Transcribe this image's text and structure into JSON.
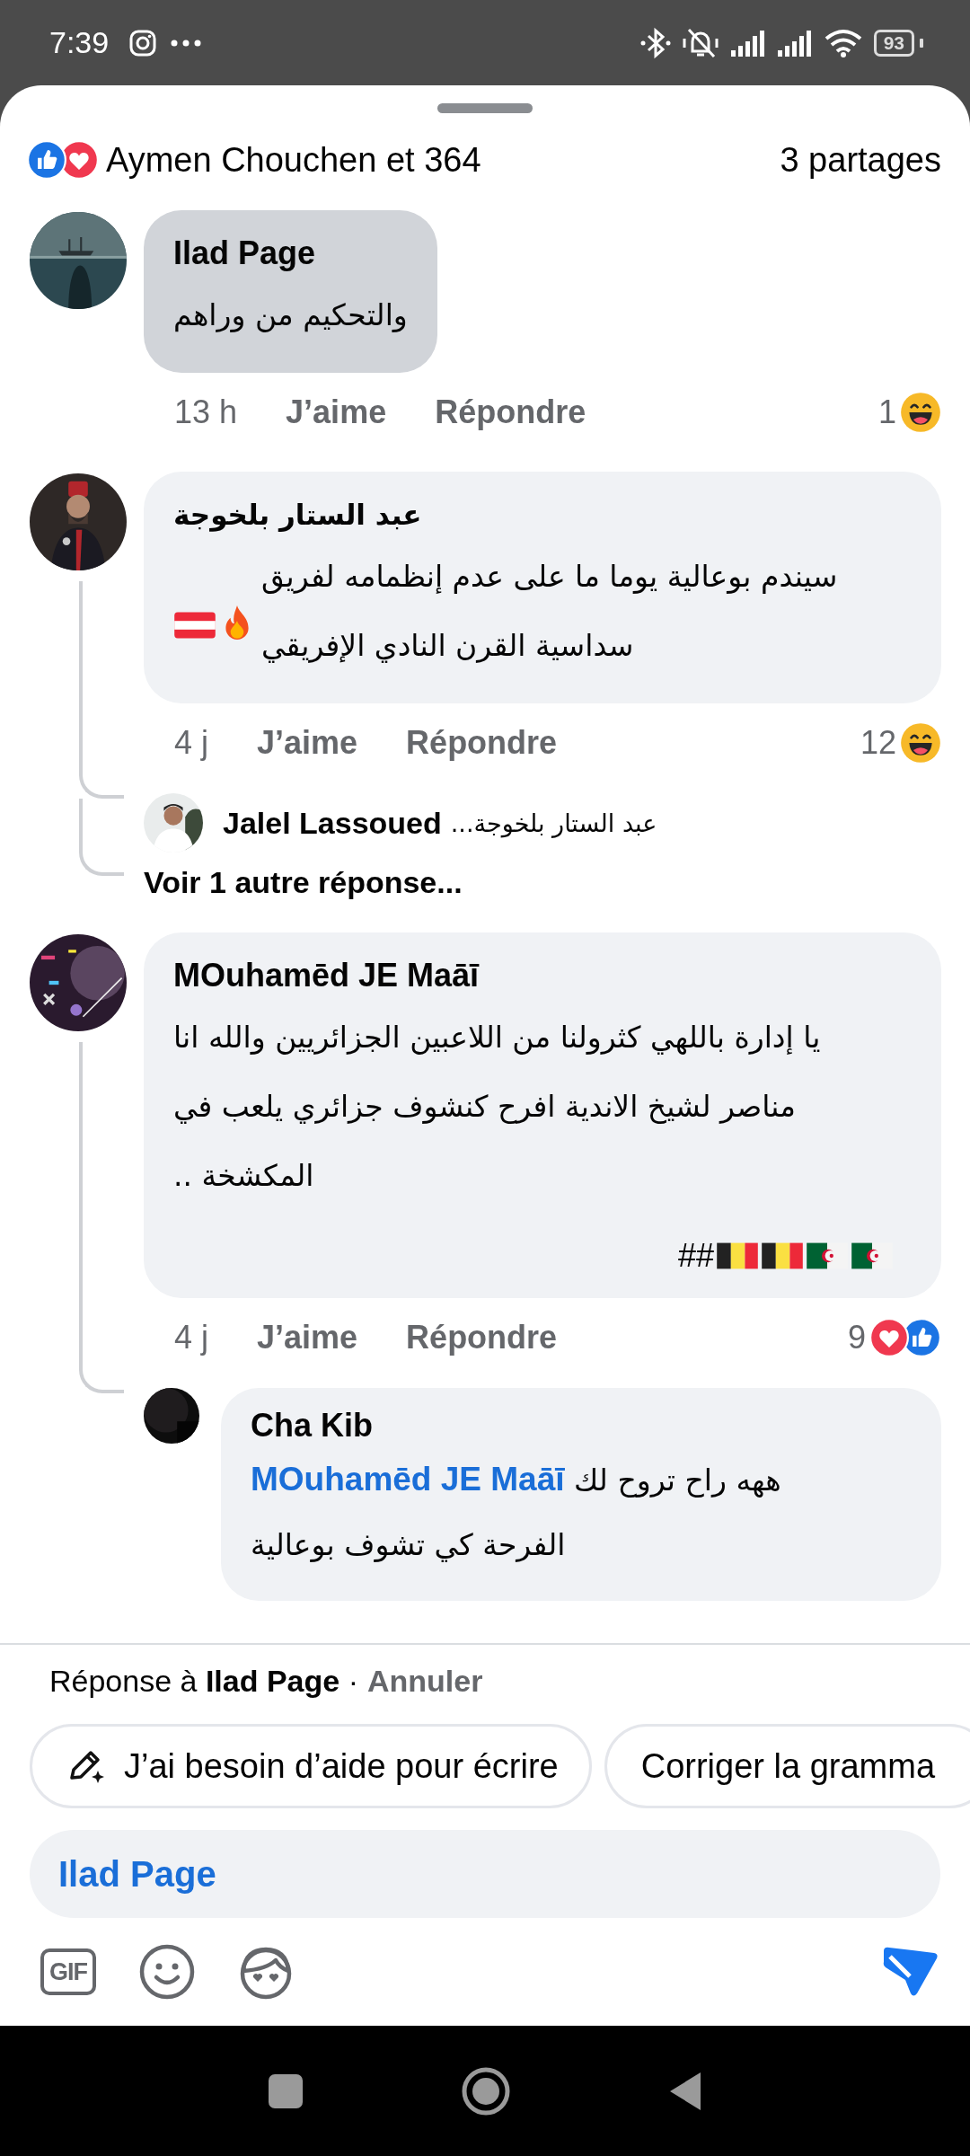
{
  "status_bar": {
    "time": "7:39",
    "battery": "93"
  },
  "summary": {
    "reactions": [
      {
        "kind": "like"
      },
      {
        "kind": "love"
      }
    ],
    "text": "Aymen Chouchen et 364",
    "shares": "3 partages"
  },
  "comments": [
    {
      "author": "Ilad Page",
      "text": "والتحكيم من وراهم",
      "selected": true,
      "time": "13 h",
      "like": "J’aime",
      "reply": "Répondre",
      "count": "1",
      "reactions": [
        {
          "kind": "haha"
        }
      ]
    },
    {
      "author": "عبد الستار بلخوجة",
      "text": "سيندم بوعالية يوما ما على عدم إنظمامه لفريق\nسداسية القرن النادي الإفريقي",
      "emojis": [
        {
          "kind": "flag_at"
        },
        {
          "kind": "fire"
        }
      ],
      "selected": false,
      "time": "4 j",
      "like": "J’aime",
      "reply": "Répondre",
      "count": "12",
      "reactions": [
        {
          "kind": "haha"
        }
      ],
      "reply_preview": {
        "author": "Jalel Lassoued",
        "text": "عبد الستار بلخوجة..."
      },
      "more_replies": "Voir 1 autre réponse..."
    },
    {
      "author": "MOuhamēd JE Maāī",
      "text": "يا إدارة باللهي كثرولنا من اللاعبين الجزائريين والله انا\nمناصر لشيخ الاندية افرح كنشوف جزائري يلعب في\nالمكشخة ..",
      "tag_line": {
        "text": "##",
        "emojis": [
          {
            "kind": "flag_be"
          },
          {
            "kind": "flag_be"
          },
          {
            "kind": "flag_dz"
          },
          {
            "kind": "flag_dz"
          }
        ]
      },
      "selected": false,
      "time": "4 j",
      "like": "J’aime",
      "reply": "Répondre",
      "count": "9",
      "reactions": [
        {
          "kind": "love"
        },
        {
          "kind": "like"
        }
      ],
      "replies": [
        {
          "author": "Cha Kib",
          "mention": "MOuhamēd JE Maāī",
          "text": " ههه راح تروح لك\nالفرحة كي تشوف بوعالية",
          "selected": false
        }
      ]
    }
  ],
  "composer": {
    "reply_context": "Réponse à **Ilad Page** ·",
    "cancel": "Annuler",
    "suggestions": [
      {
        "kind": "ai_write",
        "label": "J’ai besoin d’aide pour écrire"
      },
      {
        "kind": "plain",
        "label": "Corriger la gramma"
      }
    ],
    "value": "Ilad Page",
    "gif_label": "GIF"
  }
}
